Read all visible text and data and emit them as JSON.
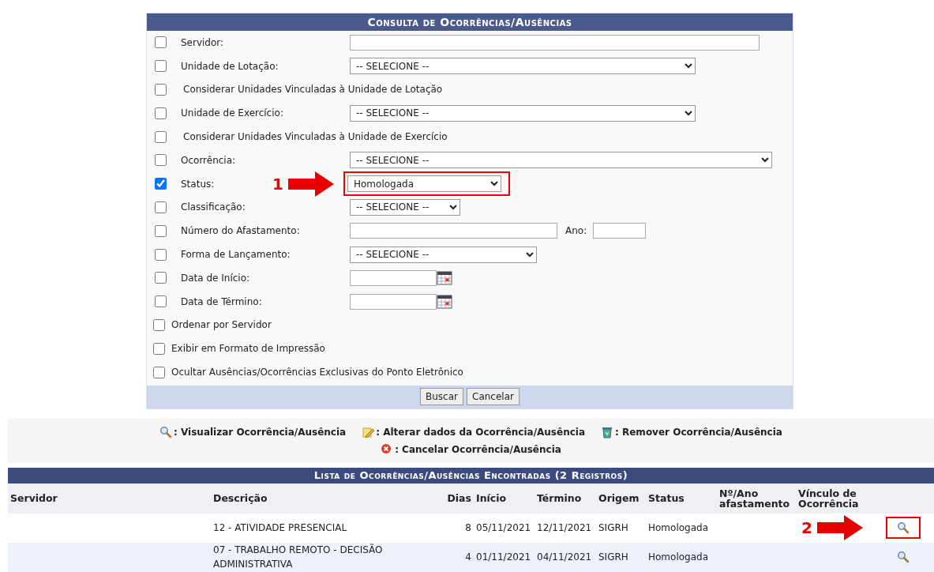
{
  "form": {
    "title": "Consulta de Ocorrências/Ausências",
    "rows": [
      {
        "kind": "text",
        "label": "Servidor:",
        "checked": false
      },
      {
        "kind": "select",
        "label": "Unidade de Lotação:",
        "checked": false,
        "value": "-- SELECIONE --"
      },
      {
        "kind": "subopt",
        "label": "Considerar Unidades Vinculadas à Unidade de Lotação",
        "checked": false
      },
      {
        "kind": "select",
        "label": "Unidade de Exercício:",
        "checked": false,
        "value": "-- SELECIONE --"
      },
      {
        "kind": "subopt",
        "label": "Considerar Unidades Vinculadas à Unidade de Exercício",
        "checked": false
      },
      {
        "kind": "select",
        "label": "Ocorrência:",
        "checked": false,
        "value": "-- SELECIONE --"
      },
      {
        "kind": "select",
        "label": "Status:",
        "checked": true,
        "value": "Homologada",
        "annotation": "1"
      },
      {
        "kind": "select",
        "label": "Classificação:",
        "checked": false,
        "value": "-- SELECIONE --"
      },
      {
        "kind": "textyear",
        "label": "Número do Afastamento:",
        "checked": false,
        "year_label": "Ano:"
      },
      {
        "kind": "select",
        "label": "Forma de Lançamento:",
        "checked": false,
        "value": "-- SELECIONE --"
      },
      {
        "kind": "date",
        "label": "Data de Início:",
        "checked": false
      },
      {
        "kind": "date",
        "label": "Data de Término:",
        "checked": false
      },
      {
        "kind": "option",
        "label": "Ordenar por Servidor",
        "checked": false
      },
      {
        "kind": "option",
        "label": "Exibir em Formato de Impressão",
        "checked": false
      },
      {
        "kind": "option",
        "label": "Ocultar Ausências/Ocorrências Exclusivas do Ponto Eletrônico",
        "checked": false
      }
    ],
    "buttons": [
      "Buscar",
      "Cancelar"
    ]
  },
  "legend": [
    {
      "kind": "view",
      "text": ": Visualizar Ocorrência/Ausência"
    },
    {
      "kind": "edit",
      "text": ": Alterar dados da Ocorrência/Ausência"
    },
    {
      "kind": "remove",
      "text": ": Remover Ocorrência/Ausência"
    },
    {
      "kind": "cancel",
      "text": ": Cancelar Ocorrência/Ausência"
    }
  ],
  "results": {
    "title": "Lista de Ocorrências/Ausências Encontradas (2 Registros)",
    "columns": [
      "Servidor",
      "Descrição",
      "Dias",
      "Início",
      "Término",
      "Origem",
      "Status",
      "Nº/Ano afastamento",
      "Vínculo de Ocorrência"
    ],
    "rows": [
      {
        "cells": [
          "",
          "12 - ATIVIDADE PRESENCIAL",
          "8",
          "05/11/2021",
          "12/11/2021",
          "SIGRH",
          "Homologada",
          "",
          ""
        ],
        "annotation": "2"
      },
      {
        "cells": [
          "",
          "07 - TRABALHO REMOTO - DECISÃO ADMINISTRATIVA",
          "4",
          "01/11/2021",
          "04/11/2021",
          "SIGRH",
          "Homologada",
          "",
          ""
        ]
      }
    ]
  }
}
